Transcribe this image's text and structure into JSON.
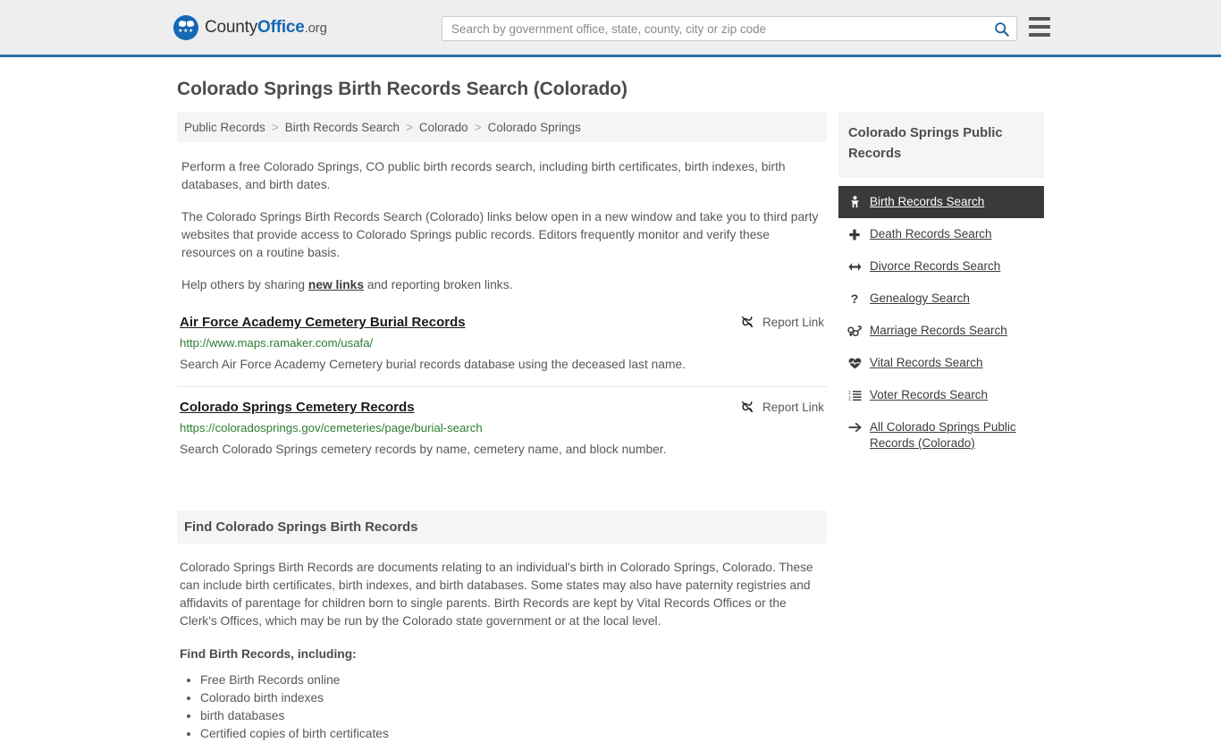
{
  "header": {
    "logo": {
      "part1": "County",
      "part2": "Office",
      "tld": ".org",
      "stars": "★★★"
    },
    "search": {
      "placeholder": "Search by government office, state, county, city or zip code",
      "value": "",
      "icon": "search-icon"
    },
    "menu_icon": "hamburger-menu-icon"
  },
  "page": {
    "title": "Colorado Springs Birth Records Search (Colorado)"
  },
  "breadcrumb": {
    "items": [
      {
        "label": "Public Records",
        "current": false
      },
      {
        "label": "Birth Records Search",
        "current": false
      },
      {
        "label": "Colorado",
        "current": false
      },
      {
        "label": "Colorado Springs",
        "current": true
      }
    ],
    "separator": ">"
  },
  "intro": {
    "p1": "Perform a free Colorado Springs, CO public birth records search, including birth certificates, birth indexes, birth databases, and birth dates.",
    "p2": "The Colorado Springs Birth Records Search (Colorado) links below open in a new window and take you to third party websites that provide access to Colorado Springs public records. Editors frequently monitor and verify these resources on a routine basis.",
    "p3_before": "Help others by sharing ",
    "p3_link": "new links",
    "p3_after": " and reporting broken links."
  },
  "results": [
    {
      "title": "Air Force Academy Cemetery Burial Records",
      "url": "http://www.maps.ramaker.com/usafa/",
      "description": "Search Air Force Academy Cemetery burial records database using the deceased last name.",
      "report_label": "Report Link",
      "report_icon": "broken-link-icon"
    },
    {
      "title": "Colorado Springs Cemetery Records",
      "url": "https://coloradosprings.gov/cemeteries/page/burial-search",
      "description": "Search Colorado Springs cemetery records by name, cemetery name, and block number.",
      "report_label": "Report Link",
      "report_icon": "broken-link-icon"
    }
  ],
  "section": {
    "heading": "Find Colorado Springs Birth Records",
    "paragraph": "Colorado Springs Birth Records are documents relating to an individual's birth in Colorado Springs, Colorado. These can include birth certificates, birth indexes, and birth databases. Some states may also have paternity registries and affidavits of parentage for children born to single parents. Birth Records are kept by Vital Records Offices or the Clerk's Offices, which may be run by the Colorado state government or at the local level.",
    "list_heading": "Find Birth Records, including:",
    "list_items": [
      "Free Birth Records online",
      "Colorado birth indexes",
      "birth databases",
      "Certified copies of birth certificates"
    ]
  },
  "sidebar": {
    "heading": "Colorado Springs Public Records",
    "items": [
      {
        "label": "Birth Records Search",
        "icon": "baby-icon",
        "glyph": "♀",
        "active": true
      },
      {
        "label": "Death Records Search",
        "icon": "cross-icon",
        "glyph": "✚",
        "active": false
      },
      {
        "label": "Divorce Records Search",
        "icon": "left-right-arrow-icon",
        "glyph": "↔",
        "active": false
      },
      {
        "label": "Genealogy Search",
        "icon": "question-mark-icon",
        "glyph": "?",
        "active": false
      },
      {
        "label": "Marriage Records Search",
        "icon": "venus-mars-icon",
        "glyph": "⚥",
        "active": false
      },
      {
        "label": "Vital Records Search",
        "icon": "heartbeat-icon",
        "glyph": "♥",
        "active": false
      },
      {
        "label": "Voter Records Search",
        "icon": "ordered-list-icon",
        "glyph": "≔",
        "active": false
      },
      {
        "label": "All Colorado Springs Public Records (Colorado)",
        "icon": "arrow-right-icon",
        "glyph": "→",
        "active": false
      }
    ]
  },
  "colors": {
    "header_bg": "#eeeeee",
    "header_border": "#2e6da4",
    "brand_blue": "#1668b3",
    "text": "#58585a",
    "heading": "#4c4c4e",
    "url_green": "#2e7d32",
    "active_bg": "#3a3a3a",
    "panel_bg": "#f5f5f5"
  }
}
